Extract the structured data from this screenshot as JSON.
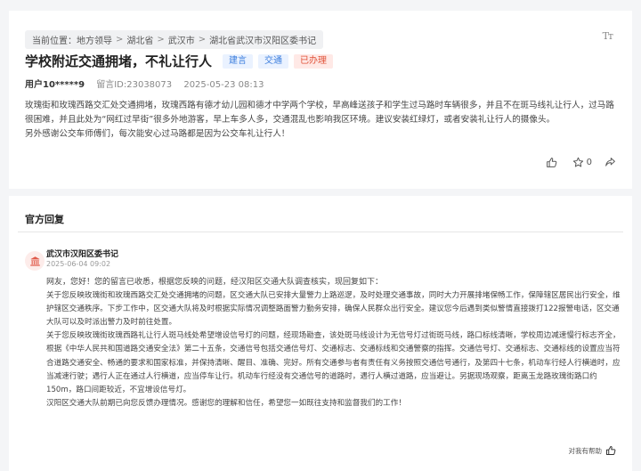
{
  "breadcrumb": {
    "label": "当前位置：",
    "items": [
      "地方领导",
      "湖北省",
      "武汉市",
      "湖北省武汉市汉阳区委书记"
    ]
  },
  "font_toggle": "Tт",
  "post": {
    "title": "学校附近交通拥堵，不礼让行人",
    "tags": [
      {
        "label": "建言",
        "color": "#3b7ddd"
      },
      {
        "label": "交通",
        "color": "#3b7ddd"
      },
      {
        "label": "已办理",
        "color": "#e0533a"
      }
    ],
    "user": "用户10*****9",
    "message_id": "留言ID:23038073",
    "date": "2025-05-23 08:13",
    "paragraphs": [
      "玫瑰街和玫瑰西路交汇处交通拥堵，玫瑰西路有德才幼儿园和德才中学两个学校，早高峰送孩子和学生过马路时车辆很多，并且不在斑马线礼让行人，过马路很困难，并且此处为“网红过早街”很多外地游客，早上车多人多，交通混乱也影响我区环境。建议安装红绿灯，或者安装礼让行人的摄像头。",
      "另外感谢公交车师傅们，每次能安心过马路都是因为公交车礼让行人！"
    ],
    "like_count": "",
    "star_count": "0"
  },
  "reply": {
    "heading": "官方回复",
    "org": "武汉市汉阳区委书记",
    "time": "2025-06-04 09:02",
    "greeting": "网友，您好！您的留言已收悉，根据您反映的问题，经汉阳区交通大队调查核实，现回复如下：",
    "paragraphs": [
      "关于您反映玫瑰街和玫瑰西路交汇处交通拥堵的问题，区交通大队已安排大量警力上路巡逻，及时处理交通事故，同时大力开展排堵保畅工作，保障辖区居民出行安全，维护辖区交通秩序。下步工作中，区交通大队将及时根据实际情况调整路面警力勤务安排，确保人民群众出行安全。建议您今后遇到类似警情直接拨打122报警电话，区交通大队可以及时派出警力及时前往处置。",
      "关于您反映玫瑰街玫瑰西路礼让行人斑马线处希望增设信号灯的问题，经现场勘查，该处斑马线设计为无信号灯过街斑马线，路口标线清晰，学校周边减速慢行标志齐全，根据《中华人民共和国道路交通安全法》第二十五条，交通信号包括交通信号灯、交通标志、交通标线和交通警察的指挥。交通信号灯、交通标志、交通标线的设置应当符合道路交通安全、畅通的要求和国家标准，并保持清晰、醒目、准确、完好。所有交通参与者有责任有义务按照交通信号通行，及第四十七条，机动车行经人行横道时，应当减速行驶；遇行人正在通过人行横道，应当停车让行。机动车行经没有交通信号的道路时，遇行人横过道路，应当避让。另据现场观察，距离玉龙路玫瑰街路口约150m，路口间距较近，不宜增设信号灯。",
      "汉阳区交通大队前期已向您反馈办理情况。感谢您的理解和信任，希望您一如既往支持和监督我们的工作！"
    ],
    "helpful_label": "对我有帮助"
  },
  "colors": {
    "blue_tag_bg": "#eaf2ff",
    "red_tag_bg": "#ffe9e6",
    "avatar_bg": "#fdecea",
    "avatar_icon": "#e05a4a"
  }
}
